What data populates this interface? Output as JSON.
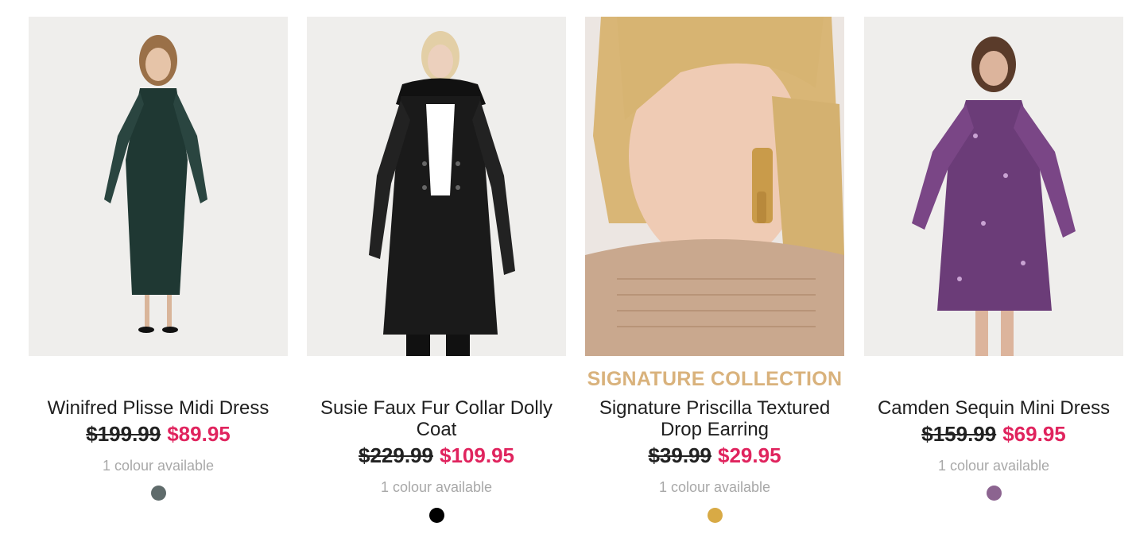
{
  "theme": {
    "sale_color": "#e0245e",
    "badge_color": "#d9b27c"
  },
  "products": [
    {
      "name": "Winifred Plisse Midi Dress",
      "badge": "",
      "was_price": "$199.99",
      "now_price": "$89.95",
      "colours_text": "1 colour available",
      "swatch_color": "#5f6b6b",
      "image_icon": "green-midi-dress-photo"
    },
    {
      "name": "Susie Faux Fur Collar Dolly Coat",
      "badge": "",
      "was_price": "$229.99",
      "now_price": "$109.95",
      "colours_text": "1 colour available",
      "swatch_color": "#000000",
      "image_icon": "black-coat-photo"
    },
    {
      "name": "Signature Priscilla Textured Drop Earring",
      "badge": "SIGNATURE COLLECTION",
      "was_price": "$39.99",
      "now_price": "$29.95",
      "colours_text": "1 colour available",
      "swatch_color": "#d8aa45",
      "image_icon": "gold-earring-photo"
    },
    {
      "name": "Camden Sequin Mini Dress",
      "badge": "",
      "was_price": "$159.99",
      "now_price": "$69.95",
      "colours_text": "1 colour available",
      "swatch_color": "#8c6490",
      "image_icon": "purple-sequin-dress-photo"
    }
  ]
}
